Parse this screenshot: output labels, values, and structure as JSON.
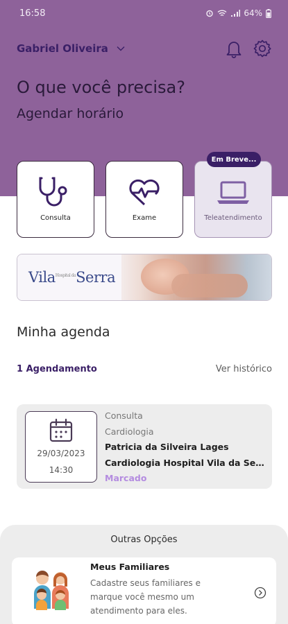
{
  "status_bar": {
    "time": "16:58",
    "battery": "64%"
  },
  "header": {
    "user_name": "Gabriel Oliveira"
  },
  "hero": {
    "title": "O que você precisa?",
    "subtitle": "Agendar horário"
  },
  "services": [
    {
      "label": "Consulta",
      "icon": "stethoscope-icon"
    },
    {
      "label": "Exame",
      "icon": "heartbeat-icon"
    },
    {
      "label": "Teleatendimento",
      "icon": "laptop-icon",
      "badge": "Em Breve..."
    }
  ],
  "banner": {
    "logo_main": "Vila",
    "logo_small": "Hospital da",
    "logo_second": "Serra"
  },
  "agenda": {
    "title": "Minha agenda",
    "count_label": "1 Agendamento",
    "history_label": "Ver histórico",
    "appointment": {
      "date": "29/03/2023",
      "time": "14:30",
      "type": "Consulta",
      "specialty": "Cardiologia",
      "doctor": "Patricia da Silveira Lages",
      "location": "Cardiologia Hospital Vila da Serra",
      "status": "Marcado"
    }
  },
  "other_options": {
    "title": "Outras Opções",
    "family": {
      "title": "Meus Familiares",
      "description": "Cadastre seus familiares e marque você mesmo um atendimento para eles."
    }
  },
  "colors": {
    "primary": "#8e629a",
    "dark_purple": "#3a1f66",
    "status": "#b48ce0"
  }
}
